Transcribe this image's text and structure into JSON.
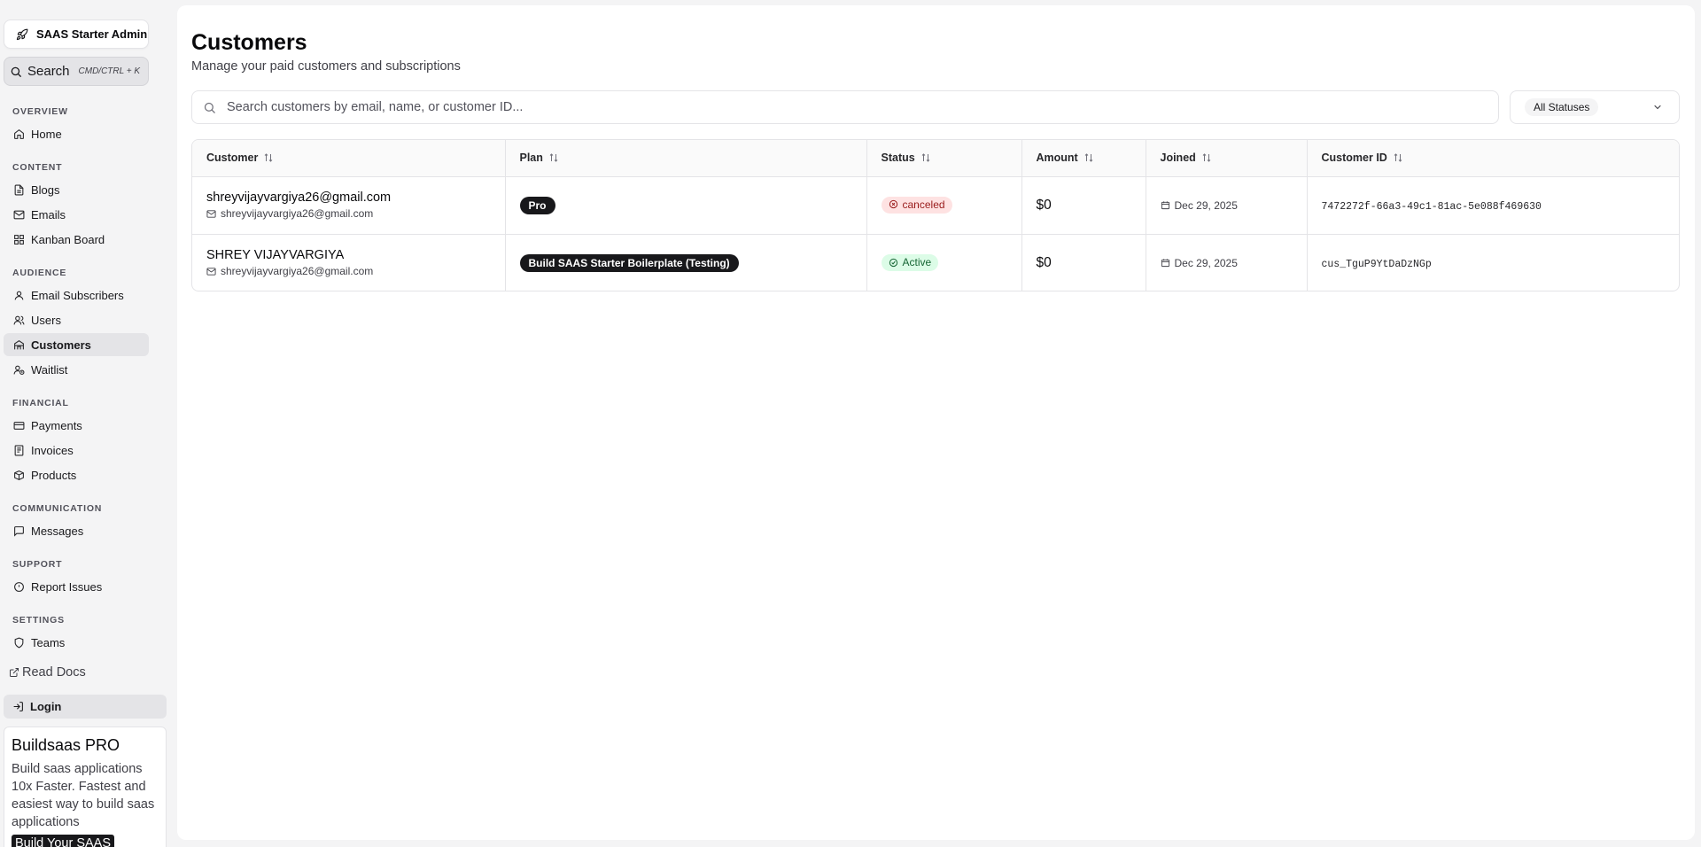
{
  "sidebar": {
    "brand": "SAAS Starter Admin",
    "search": {
      "label": "Search",
      "shortcut": "CMD/CTRL + K"
    },
    "groups": [
      {
        "label": "OVERVIEW",
        "items": [
          {
            "label": "Home",
            "icon": "home-icon"
          }
        ]
      },
      {
        "label": "CONTENT",
        "items": [
          {
            "label": "Blogs",
            "icon": "file-text-icon"
          },
          {
            "label": "Emails",
            "icon": "mail-icon"
          },
          {
            "label": "Kanban Board",
            "icon": "grid-icon"
          }
        ]
      },
      {
        "label": "AUDIENCE",
        "items": [
          {
            "label": "Email Subscribers",
            "icon": "user-icon"
          },
          {
            "label": "Users",
            "icon": "users-icon"
          },
          {
            "label": "Customers",
            "icon": "customers-icon",
            "active": true
          },
          {
            "label": "Waitlist",
            "icon": "user-clock-icon"
          }
        ]
      },
      {
        "label": "FINANCIAL",
        "items": [
          {
            "label": "Payments",
            "icon": "credit-card-icon"
          },
          {
            "label": "Invoices",
            "icon": "receipt-icon"
          },
          {
            "label": "Products",
            "icon": "package-icon"
          }
        ]
      },
      {
        "label": "COMMUNICATION",
        "items": [
          {
            "label": "Messages",
            "icon": "message-icon"
          }
        ]
      },
      {
        "label": "SUPPORT",
        "items": [
          {
            "label": "Report Issues",
            "icon": "alert-circle-icon"
          }
        ]
      },
      {
        "label": "SETTINGS",
        "items": [
          {
            "label": "Teams",
            "icon": "shield-icon"
          }
        ]
      }
    ],
    "read_docs": "Read Docs",
    "login": "Login",
    "promo": {
      "title": "Buildsaas PRO",
      "description": "Build saas applications 10x Faster. Fastest and easiest way to build saas applications",
      "button": "Build Your SAAS"
    }
  },
  "main": {
    "title": "Customers",
    "subtitle": "Manage your paid customers and subscriptions",
    "search_placeholder": "Search customers by email, name, or customer ID...",
    "status_filter": "All Statuses",
    "table": {
      "columns": [
        "Customer",
        "Plan",
        "Status",
        "Amount",
        "Joined",
        "Customer ID"
      ],
      "rows": [
        {
          "name": "shreyvijayvargiya26@gmail.com",
          "email": "shreyvijayvargiya26@gmail.com",
          "plan": "Pro",
          "status": "canceled",
          "amount": "$0",
          "joined": "Dec 29, 2025",
          "customer_id": "7472272f-66a3-49c1-81ac-5e088f469630"
        },
        {
          "name": "SHREY VIJAYVARGIYA",
          "email": "shreyvijayvargiya26@gmail.com",
          "plan": "Build SAAS Starter Boilerplate (Testing)",
          "status": "Active",
          "amount": "$0",
          "joined": "Dec 29, 2025",
          "customer_id": "cus_TguP9YtDaDzNGp"
        }
      ]
    }
  },
  "colors": {
    "canceled_bg": "#fee2e2",
    "canceled_text": "#991b1b",
    "active_bg": "#dcfce7",
    "active_text": "#166534",
    "plan_badge_bg": "#18181b"
  }
}
